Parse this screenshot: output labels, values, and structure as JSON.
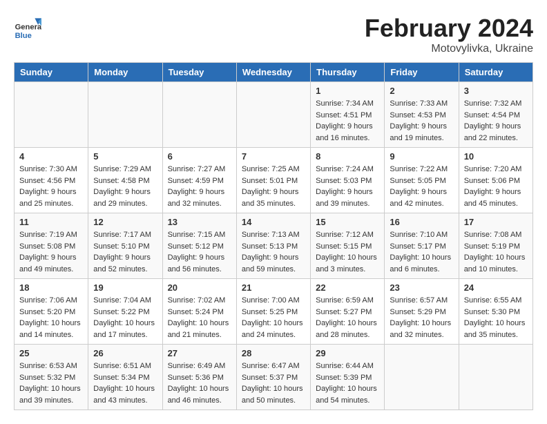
{
  "header": {
    "logo_general": "General",
    "logo_blue": "Blue",
    "month_year": "February 2024",
    "location": "Motovylivka, Ukraine"
  },
  "weekdays": [
    "Sunday",
    "Monday",
    "Tuesday",
    "Wednesday",
    "Thursday",
    "Friday",
    "Saturday"
  ],
  "weeks": [
    [
      {
        "day": "",
        "sunrise": "",
        "sunset": "",
        "daylight": ""
      },
      {
        "day": "",
        "sunrise": "",
        "sunset": "",
        "daylight": ""
      },
      {
        "day": "",
        "sunrise": "",
        "sunset": "",
        "daylight": ""
      },
      {
        "day": "",
        "sunrise": "",
        "sunset": "",
        "daylight": ""
      },
      {
        "day": "1",
        "sunrise": "Sunrise: 7:34 AM",
        "sunset": "Sunset: 4:51 PM",
        "daylight": "Daylight: 9 hours and 16 minutes."
      },
      {
        "day": "2",
        "sunrise": "Sunrise: 7:33 AM",
        "sunset": "Sunset: 4:53 PM",
        "daylight": "Daylight: 9 hours and 19 minutes."
      },
      {
        "day": "3",
        "sunrise": "Sunrise: 7:32 AM",
        "sunset": "Sunset: 4:54 PM",
        "daylight": "Daylight: 9 hours and 22 minutes."
      }
    ],
    [
      {
        "day": "4",
        "sunrise": "Sunrise: 7:30 AM",
        "sunset": "Sunset: 4:56 PM",
        "daylight": "Daylight: 9 hours and 25 minutes."
      },
      {
        "day": "5",
        "sunrise": "Sunrise: 7:29 AM",
        "sunset": "Sunset: 4:58 PM",
        "daylight": "Daylight: 9 hours and 29 minutes."
      },
      {
        "day": "6",
        "sunrise": "Sunrise: 7:27 AM",
        "sunset": "Sunset: 4:59 PM",
        "daylight": "Daylight: 9 hours and 32 minutes."
      },
      {
        "day": "7",
        "sunrise": "Sunrise: 7:25 AM",
        "sunset": "Sunset: 5:01 PM",
        "daylight": "Daylight: 9 hours and 35 minutes."
      },
      {
        "day": "8",
        "sunrise": "Sunrise: 7:24 AM",
        "sunset": "Sunset: 5:03 PM",
        "daylight": "Daylight: 9 hours and 39 minutes."
      },
      {
        "day": "9",
        "sunrise": "Sunrise: 7:22 AM",
        "sunset": "Sunset: 5:05 PM",
        "daylight": "Daylight: 9 hours and 42 minutes."
      },
      {
        "day": "10",
        "sunrise": "Sunrise: 7:20 AM",
        "sunset": "Sunset: 5:06 PM",
        "daylight": "Daylight: 9 hours and 45 minutes."
      }
    ],
    [
      {
        "day": "11",
        "sunrise": "Sunrise: 7:19 AM",
        "sunset": "Sunset: 5:08 PM",
        "daylight": "Daylight: 9 hours and 49 minutes."
      },
      {
        "day": "12",
        "sunrise": "Sunrise: 7:17 AM",
        "sunset": "Sunset: 5:10 PM",
        "daylight": "Daylight: 9 hours and 52 minutes."
      },
      {
        "day": "13",
        "sunrise": "Sunrise: 7:15 AM",
        "sunset": "Sunset: 5:12 PM",
        "daylight": "Daylight: 9 hours and 56 minutes."
      },
      {
        "day": "14",
        "sunrise": "Sunrise: 7:13 AM",
        "sunset": "Sunset: 5:13 PM",
        "daylight": "Daylight: 9 hours and 59 minutes."
      },
      {
        "day": "15",
        "sunrise": "Sunrise: 7:12 AM",
        "sunset": "Sunset: 5:15 PM",
        "daylight": "Daylight: 10 hours and 3 minutes."
      },
      {
        "day": "16",
        "sunrise": "Sunrise: 7:10 AM",
        "sunset": "Sunset: 5:17 PM",
        "daylight": "Daylight: 10 hours and 6 minutes."
      },
      {
        "day": "17",
        "sunrise": "Sunrise: 7:08 AM",
        "sunset": "Sunset: 5:19 PM",
        "daylight": "Daylight: 10 hours and 10 minutes."
      }
    ],
    [
      {
        "day": "18",
        "sunrise": "Sunrise: 7:06 AM",
        "sunset": "Sunset: 5:20 PM",
        "daylight": "Daylight: 10 hours and 14 minutes."
      },
      {
        "day": "19",
        "sunrise": "Sunrise: 7:04 AM",
        "sunset": "Sunset: 5:22 PM",
        "daylight": "Daylight: 10 hours and 17 minutes."
      },
      {
        "day": "20",
        "sunrise": "Sunrise: 7:02 AM",
        "sunset": "Sunset: 5:24 PM",
        "daylight": "Daylight: 10 hours and 21 minutes."
      },
      {
        "day": "21",
        "sunrise": "Sunrise: 7:00 AM",
        "sunset": "Sunset: 5:25 PM",
        "daylight": "Daylight: 10 hours and 24 minutes."
      },
      {
        "day": "22",
        "sunrise": "Sunrise: 6:59 AM",
        "sunset": "Sunset: 5:27 PM",
        "daylight": "Daylight: 10 hours and 28 minutes."
      },
      {
        "day": "23",
        "sunrise": "Sunrise: 6:57 AM",
        "sunset": "Sunset: 5:29 PM",
        "daylight": "Daylight: 10 hours and 32 minutes."
      },
      {
        "day": "24",
        "sunrise": "Sunrise: 6:55 AM",
        "sunset": "Sunset: 5:30 PM",
        "daylight": "Daylight: 10 hours and 35 minutes."
      }
    ],
    [
      {
        "day": "25",
        "sunrise": "Sunrise: 6:53 AM",
        "sunset": "Sunset: 5:32 PM",
        "daylight": "Daylight: 10 hours and 39 minutes."
      },
      {
        "day": "26",
        "sunrise": "Sunrise: 6:51 AM",
        "sunset": "Sunset: 5:34 PM",
        "daylight": "Daylight: 10 hours and 43 minutes."
      },
      {
        "day": "27",
        "sunrise": "Sunrise: 6:49 AM",
        "sunset": "Sunset: 5:36 PM",
        "daylight": "Daylight: 10 hours and 46 minutes."
      },
      {
        "day": "28",
        "sunrise": "Sunrise: 6:47 AM",
        "sunset": "Sunset: 5:37 PM",
        "daylight": "Daylight: 10 hours and 50 minutes."
      },
      {
        "day": "29",
        "sunrise": "Sunrise: 6:44 AM",
        "sunset": "Sunset: 5:39 PM",
        "daylight": "Daylight: 10 hours and 54 minutes."
      },
      {
        "day": "",
        "sunrise": "",
        "sunset": "",
        "daylight": ""
      },
      {
        "day": "",
        "sunrise": "",
        "sunset": "",
        "daylight": ""
      }
    ]
  ]
}
